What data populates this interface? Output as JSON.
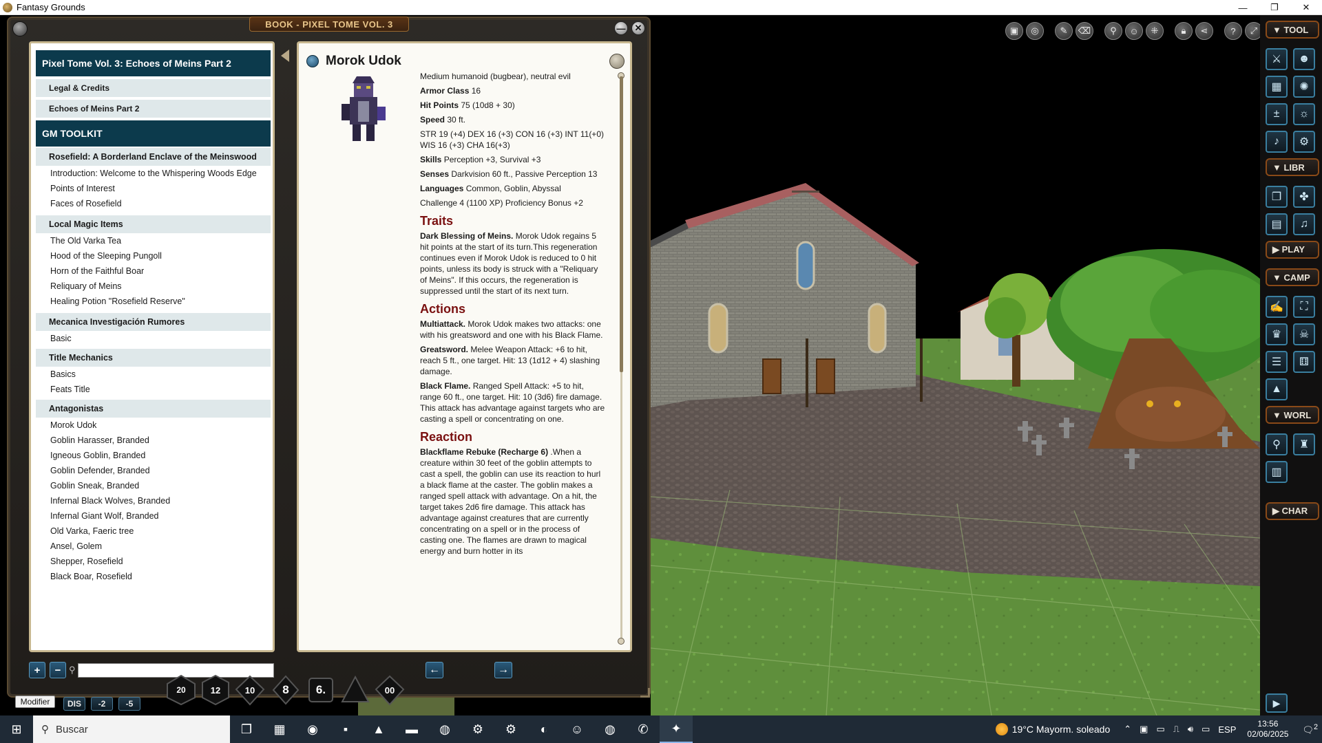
{
  "window": {
    "title": "Fantasy Grounds",
    "controls": [
      "—",
      "❐",
      "✕"
    ]
  },
  "book": {
    "tab_title": "BOOK - PIXEL TOME VOL. 3",
    "close_glyph": "✕",
    "min_glyph": "—",
    "toc": {
      "book_title": "Pixel Tome Vol. 3: Echoes of Meins Part 2",
      "chapters": [
        "Legal & Credits",
        "Echoes of Meins Part 2"
      ],
      "gm_toolkit": "GM TOOLKIT",
      "sections": [
        {
          "title": "Rosefield: A Borderland Enclave of the Meinswood",
          "items": [
            "Introduction: Welcome to the Whispering Woods Edge",
            "Points of Interest",
            "Faces of Rosefield"
          ]
        },
        {
          "title": "Local Magic Items",
          "items": [
            "The Old Varka Tea",
            "Hood of the Sleeping Pungoll",
            "Horn of the Faithful Boar",
            "Reliquary of Meins",
            "Healing Potion \"Rosefield Reserve\""
          ]
        },
        {
          "title": "Mecanica Investigación Rumores",
          "items": [
            "Basic"
          ]
        },
        {
          "title": "Title Mechanics",
          "items": [
            "Basics",
            "Feats Title"
          ]
        },
        {
          "title": "Antagonistas",
          "items": [
            "Morok Udok",
            "Goblin Harasser, Branded",
            "Igneous Goblin, Branded",
            "Goblin Defender, Branded",
            "Goblin Sneak, Branded",
            "Infernal Black Wolves, Branded",
            "Infernal Giant Wolf, Branded",
            "Old Varka, Faeric tree",
            "Ansel, Golem",
            "Shepper, Rosefield",
            "Black Boar, Rosefield"
          ]
        }
      ]
    },
    "entry": {
      "name": "Morok Udok",
      "type_line": "Medium humanoid (bugbear), neutral evil",
      "armor_class_label": "Armor Class",
      "armor_class": "16",
      "hit_points_label": "Hit Points",
      "hit_points": "75 (10d8 + 30)",
      "speed_label": "Speed",
      "speed": "30 ft.",
      "abilities": "STR 19 (+4) DEX 16 (+3) CON 16 (+3) INT 11(+0) WIS 16 (+3) CHA 16(+3)",
      "skills_label": "Skills",
      "skills": "Perception +3, Survival +3",
      "senses_label": "Senses",
      "senses": "Darkvision 60 ft., Passive Perception 13",
      "languages_label": "Languages",
      "languages": "Common, Goblin, Abyssal",
      "challenge": "Challenge 4 (1100 XP) Proficiency Bonus +2",
      "traits_heading": "Traits",
      "trait1_name": "Dark Blessing of Meins.",
      "trait1_text": " Morok Udok regains 5 hit points at the start of its turn.This regeneration continues even if Morok Udok is reduced to 0 hit points, unless its body is struck with a \"Reliquary of Meins\". If this occurs, the regeneration is suppressed until the start of its next turn.",
      "actions_heading": "Actions",
      "action1_name": "Multiattack.",
      "action1_text": " Morok Udok makes two attacks: one with his greatsword and one with his Black Flame.",
      "action2_name": "Greatsword.",
      "action2_text": " Melee Weapon Attack: +6 to hit, reach 5 ft., one target. Hit: 13 (1d12 + 4) slashing damage.",
      "action3_name": "Black Flame.",
      "action3_text": " Ranged Spell Attack: +5 to hit, range 60 ft., one target. Hit: 10 (3d6) fire damage. This attack has advantage against targets who are casting a spell or concentrating on one.",
      "reaction_heading": "Reaction",
      "reaction1_name": "Blackflame Rebuke (Recharge 6)",
      "reaction1_text": " .When a creature within 30 feet of the goblin attempts to cast a spell, the goblin can use its reaction to hurl a black flame at the caster. The goblin makes a ranged spell attack with advantage. On a hit, the target takes 2d6 fire damage. This attack has advantage against creatures that are currently concentrating on a spell or in the process of casting one. The flames are drawn to magical energy and burn hotter in its"
    },
    "bottom": {
      "add_glyph": "+",
      "remove_glyph": "−",
      "search_value": "",
      "prev_glyph": "←",
      "next_glyph": "→"
    }
  },
  "dice": [
    "20",
    "12",
    "10",
    "8",
    "6.",
    "",
    "00"
  ],
  "modifier": {
    "label": "Modifier",
    "buttons": [
      "DIS",
      "-2",
      "-5"
    ]
  },
  "sidebar": {
    "sections": [
      "▼ TOOL",
      "▼ LIBR",
      "▶ PLAY",
      "▼ CAMP",
      "▼ WORL",
      "▶ CHAR"
    ],
    "tool_icons": [
      "crossed-swords-icon",
      "party-icon",
      "calendar-icon",
      "effects-icon",
      "modifiers-icon",
      "options-icon",
      "music-icon",
      "settings-icon"
    ],
    "chat_toggle": "▶"
  },
  "map_toolbar_icons": [
    "camera-icon",
    "target-icon",
    "brush-icon",
    "eraser-icon",
    "pin-icon",
    "people-icon",
    "grid-icon",
    "lock-icon",
    "share-icon",
    "help-icon",
    "expand-icon",
    "pencil-icon",
    "close-icon"
  ],
  "taskbar": {
    "search_placeholder": "Buscar",
    "weather": "19°C  Mayorm. soleado",
    "lang": "ESP",
    "time": "13:56",
    "date": "02/06/2025",
    "notif_count": "2"
  },
  "colors": {
    "toc_header": "#0c3a4c",
    "toc_band": "#dfe8ea",
    "heading_red": "#7a1010",
    "sidebar_accent": "#8a4a18",
    "button_blue": "#3a7fa0"
  }
}
